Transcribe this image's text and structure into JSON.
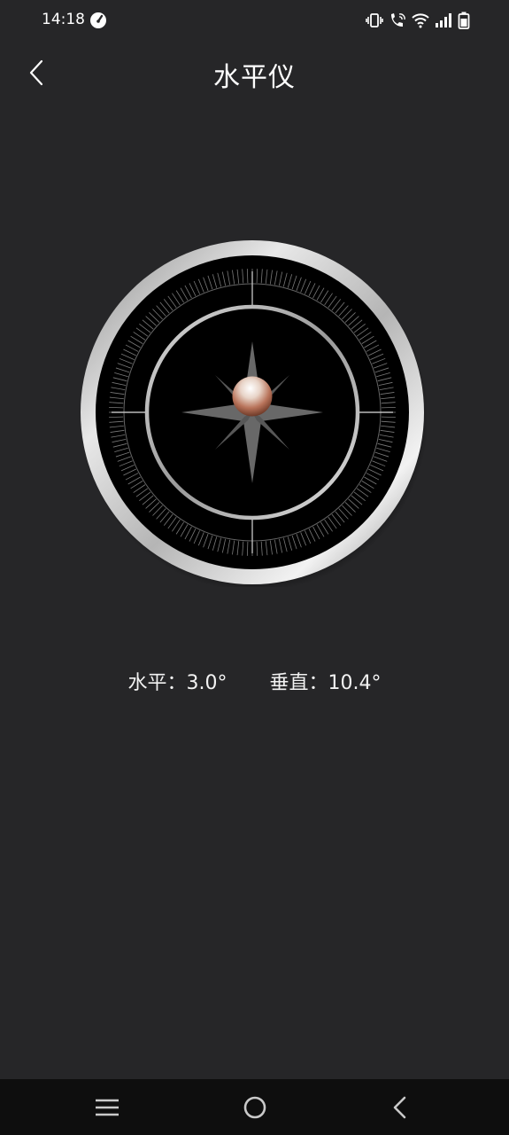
{
  "status_bar": {
    "time": "14:18",
    "icons": [
      "speedometer-icon",
      "vibrate-icon",
      "wifi-calling-icon",
      "wifi-icon",
      "signal-icon",
      "battery-icon"
    ]
  },
  "header": {
    "title": "水平仪",
    "back_icon": "chevron-left-icon"
  },
  "level": {
    "horizontal_label": "水平：",
    "horizontal_value": "3.0°",
    "vertical_label": "垂直：",
    "vertical_value": "10.4°"
  },
  "nav_bar": {
    "items": [
      "menu-icon",
      "home-icon",
      "back-icon"
    ]
  },
  "colors": {
    "background": "#262628",
    "nav_background": "#0e0e0e",
    "bubble": "#b8735a",
    "dial_face": "#000000",
    "metal_rim": "#c8c8c8"
  }
}
